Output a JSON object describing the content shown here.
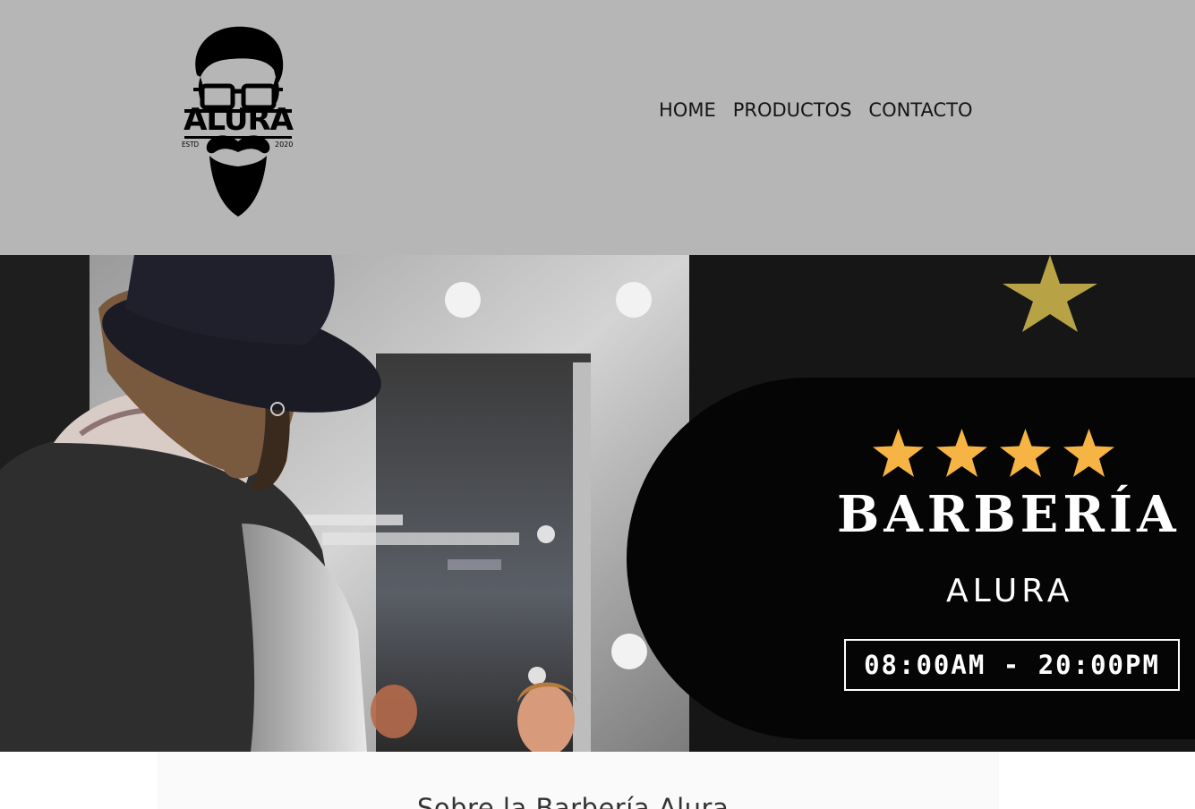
{
  "brand": {
    "logo_text": "ALURA",
    "logo_estd": "ESTD",
    "logo_year": "2020"
  },
  "nav": {
    "items": [
      "HOME",
      "PRODUCTOS",
      "CONTACTO"
    ]
  },
  "hero": {
    "title": "BARBERÍA",
    "subtitle": "ALURA",
    "hours": "08:00AM - 20:00PM",
    "star_count": 4,
    "star_color": "#f5b443"
  },
  "about": {
    "title": "Sobre la Barbería Alura"
  },
  "colors": {
    "header_bg": "#b6b6b6",
    "banner_bg": "#050505"
  }
}
